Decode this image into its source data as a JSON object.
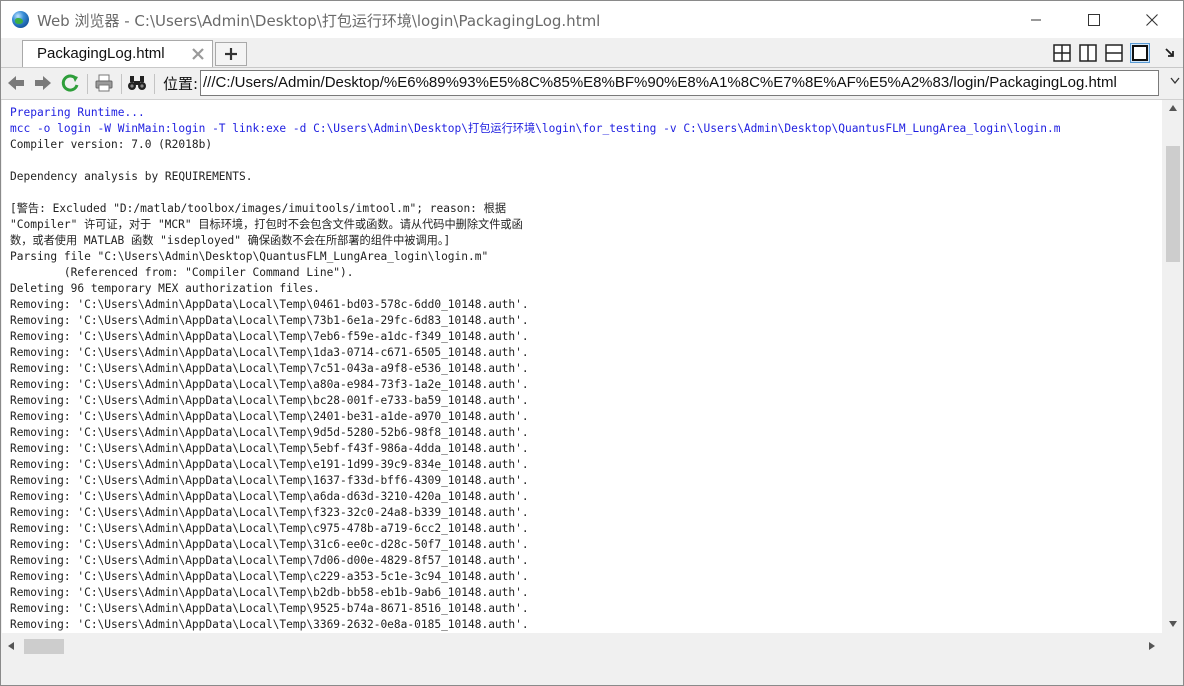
{
  "window": {
    "title": "Web 浏览器 - C:\\Users\\Admin\\Desktop\\打包运行环境\\login\\PackagingLog.html"
  },
  "tabs": [
    {
      "label": "PackagingLog.html"
    }
  ],
  "location": {
    "label": "位置:",
    "value": "///C:/Users/Admin/Desktop/%E6%89%93%E5%8C%85%E8%BF%90%E8%A1%8C%E7%8E%AF%E5%A2%83/login/PackagingLog.html"
  },
  "log": {
    "lines": [
      {
        "text": "Preparing Runtime...",
        "style": "cmd"
      },
      {
        "text": "mcc -o login -W WinMain:login -T link:exe -d C:\\Users\\Admin\\Desktop\\打包运行环境\\login\\for_testing -v C:\\Users\\Admin\\Desktop\\QuantusFLM_LungArea_login\\login.m",
        "style": "cmd"
      },
      {
        "text": "Compiler version: 7.0 (R2018b)",
        "style": ""
      },
      {
        "text": "",
        "style": ""
      },
      {
        "text": "Dependency analysis by REQUIREMENTS.",
        "style": ""
      },
      {
        "text": "",
        "style": ""
      },
      {
        "text": "[警告: Excluded \"D:/matlab/toolbox/images/imuitools/imtool.m\"; reason: 根据",
        "style": ""
      },
      {
        "text": "\"Compiler\" 许可证，对于 \"MCR\" 目标环境，打包时不会包含文件或函数。请从代码中删除文件或函",
        "style": ""
      },
      {
        "text": "数，或者使用 MATLAB 函数 \"isdeployed\" 确保函数不会在所部署的组件中被调用。]",
        "style": ""
      },
      {
        "text": "Parsing file \"C:\\Users\\Admin\\Desktop\\QuantusFLM_LungArea_login\\login.m\"",
        "style": ""
      },
      {
        "text": "\t(Referenced from: \"Compiler Command Line\").",
        "style": ""
      },
      {
        "text": "Deleting 96 temporary MEX authorization files.",
        "style": ""
      },
      {
        "text": "Removing: 'C:\\Users\\Admin\\AppData\\Local\\Temp\\0461-bd03-578c-6dd0_10148.auth'.",
        "style": ""
      },
      {
        "text": "Removing: 'C:\\Users\\Admin\\AppData\\Local\\Temp\\73b1-6e1a-29fc-6d83_10148.auth'.",
        "style": ""
      },
      {
        "text": "Removing: 'C:\\Users\\Admin\\AppData\\Local\\Temp\\7eb6-f59e-a1dc-f349_10148.auth'.",
        "style": ""
      },
      {
        "text": "Removing: 'C:\\Users\\Admin\\AppData\\Local\\Temp\\1da3-0714-c671-6505_10148.auth'.",
        "style": ""
      },
      {
        "text": "Removing: 'C:\\Users\\Admin\\AppData\\Local\\Temp\\7c51-043a-a9f8-e536_10148.auth'.",
        "style": ""
      },
      {
        "text": "Removing: 'C:\\Users\\Admin\\AppData\\Local\\Temp\\a80a-e984-73f3-1a2e_10148.auth'.",
        "style": ""
      },
      {
        "text": "Removing: 'C:\\Users\\Admin\\AppData\\Local\\Temp\\bc28-001f-e733-ba59_10148.auth'.",
        "style": ""
      },
      {
        "text": "Removing: 'C:\\Users\\Admin\\AppData\\Local\\Temp\\2401-be31-a1de-a970_10148.auth'.",
        "style": ""
      },
      {
        "text": "Removing: 'C:\\Users\\Admin\\AppData\\Local\\Temp\\9d5d-5280-52b6-98f8_10148.auth'.",
        "style": ""
      },
      {
        "text": "Removing: 'C:\\Users\\Admin\\AppData\\Local\\Temp\\5ebf-f43f-986a-4dda_10148.auth'.",
        "style": ""
      },
      {
        "text": "Removing: 'C:\\Users\\Admin\\AppData\\Local\\Temp\\e191-1d99-39c9-834e_10148.auth'.",
        "style": ""
      },
      {
        "text": "Removing: 'C:\\Users\\Admin\\AppData\\Local\\Temp\\1637-f33d-bff6-4309_10148.auth'.",
        "style": ""
      },
      {
        "text": "Removing: 'C:\\Users\\Admin\\AppData\\Local\\Temp\\a6da-d63d-3210-420a_10148.auth'.",
        "style": ""
      },
      {
        "text": "Removing: 'C:\\Users\\Admin\\AppData\\Local\\Temp\\f323-32c0-24a8-b339_10148.auth'.",
        "style": ""
      },
      {
        "text": "Removing: 'C:\\Users\\Admin\\AppData\\Local\\Temp\\c975-478b-a719-6cc2_10148.auth'.",
        "style": ""
      },
      {
        "text": "Removing: 'C:\\Users\\Admin\\AppData\\Local\\Temp\\31c6-ee0c-d28c-50f7_10148.auth'.",
        "style": ""
      },
      {
        "text": "Removing: 'C:\\Users\\Admin\\AppData\\Local\\Temp\\7d06-d00e-4829-8f57_10148.auth'.",
        "style": ""
      },
      {
        "text": "Removing: 'C:\\Users\\Admin\\AppData\\Local\\Temp\\c229-a353-5c1e-3c94_10148.auth'.",
        "style": ""
      },
      {
        "text": "Removing: 'C:\\Users\\Admin\\AppData\\Local\\Temp\\b2db-bb58-eb1b-9ab6_10148.auth'.",
        "style": ""
      },
      {
        "text": "Removing: 'C:\\Users\\Admin\\AppData\\Local\\Temp\\9525-b74a-8671-8516_10148.auth'.",
        "style": ""
      },
      {
        "text": "Removing: 'C:\\Users\\Admin\\AppData\\Local\\Temp\\3369-2632-0e8a-0185_10148.auth'.",
        "style": ""
      }
    ]
  },
  "icons": {
    "app": "globe-icon",
    "minimize": "minimize-icon",
    "maximize": "maximize-icon",
    "close": "close-icon",
    "back": "back-arrow-icon",
    "forward": "forward-arrow-icon",
    "refresh": "refresh-icon",
    "print": "print-icon",
    "find": "binoculars-icon"
  },
  "colors": {
    "command_text": "#1e1ee0",
    "log_text": "#222222",
    "refresh_green": "#2e9e3a"
  }
}
